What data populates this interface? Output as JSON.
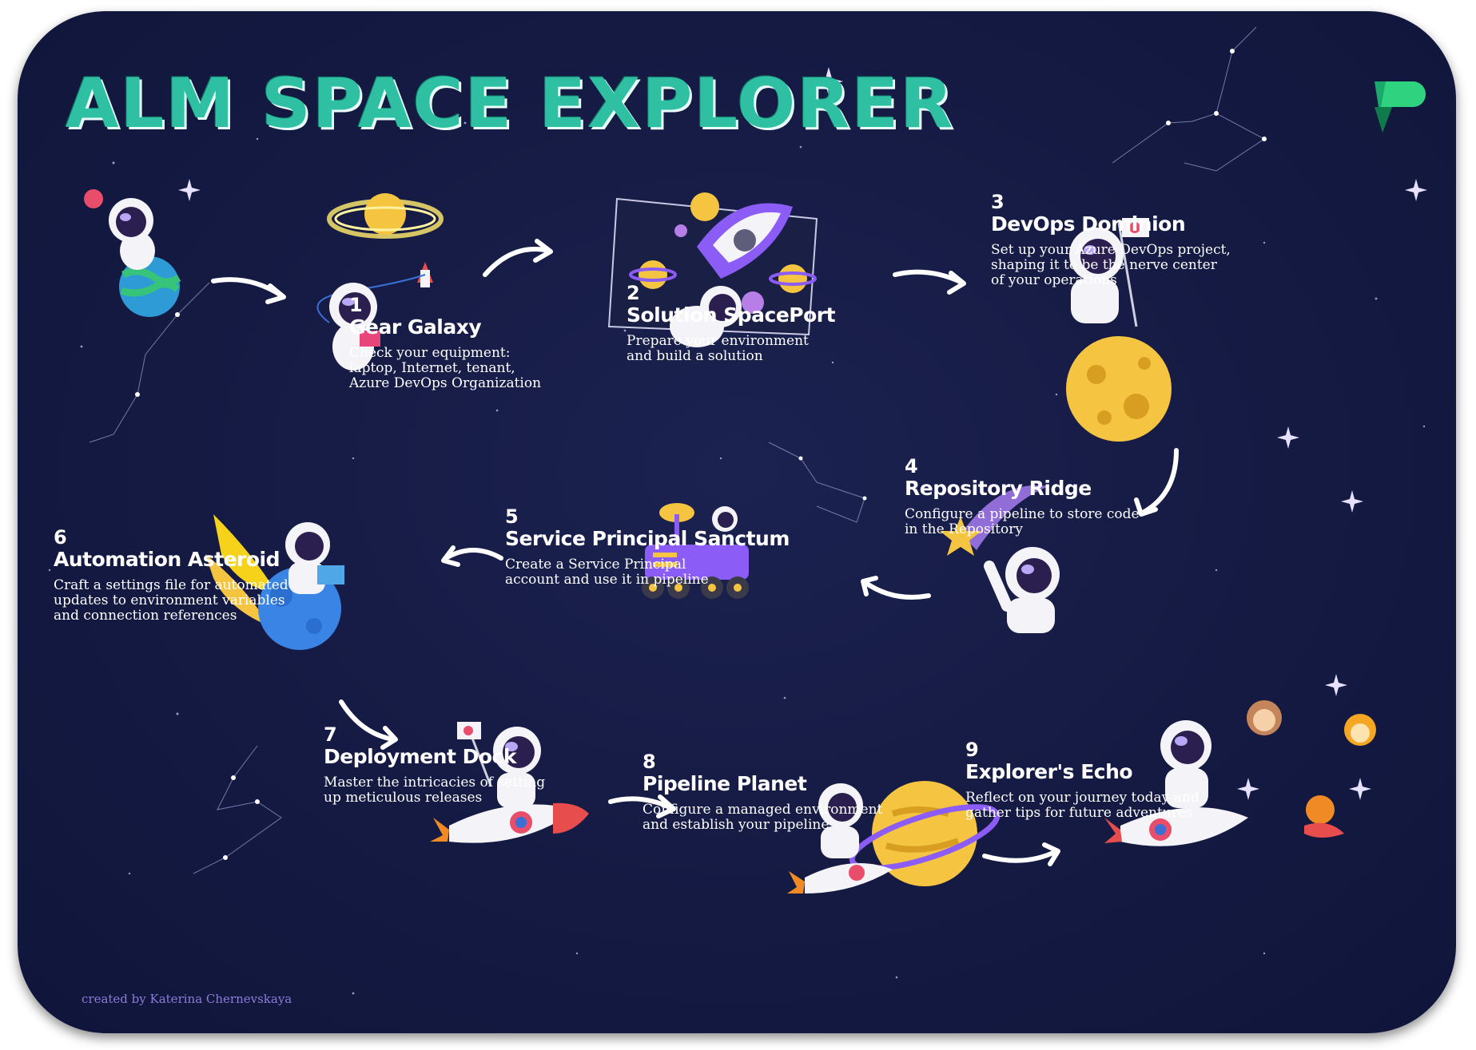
{
  "header": {
    "title": "ALM SPACE EXPLORER",
    "logo_icon": "power-platform-logo-icon"
  },
  "colors": {
    "background": "#141a42",
    "title": "#2fbfa3",
    "text": "#ffffff",
    "credit": "#8c7bd8",
    "planet_yellow": "#f5c542",
    "accent_purple": "#8b5cf6"
  },
  "steps": [
    {
      "num": "1",
      "name": "Gear Galaxy",
      "desc": [
        "Check your equipment:",
        "laptop, Internet, tenant,",
        "Azure DevOps Organization"
      ],
      "icon": "astronaut-with-rocket-icon"
    },
    {
      "num": "2",
      "name": "Solution SpacePort",
      "desc": [
        "Prepare your environment",
        "and build a solution"
      ],
      "icon": "rocket-launch-icon"
    },
    {
      "num": "3",
      "name": "DevOps Dominion",
      "desc": [
        "Set up your Azure DevOps project,",
        "shaping it to be the nerve center",
        "of your operations"
      ],
      "icon": "astronaut-on-moon-icon"
    },
    {
      "num": "4",
      "name": "Repository Ridge",
      "desc": [
        "Configure a pipeline to store code",
        "in the Repository"
      ],
      "icon": "astronaut-pointing-icon"
    },
    {
      "num": "5",
      "name": "Service Principal Sanctum",
      "desc": [
        "Create a Service Principal",
        "account and use it in pipeline"
      ],
      "icon": "space-rover-icon"
    },
    {
      "num": "6",
      "name": "Automation Asteroid",
      "desc": [
        "Craft a settings file for automated",
        "updates to environment variables",
        "and connection references"
      ],
      "icon": "astronaut-on-asteroid-icon"
    },
    {
      "num": "7",
      "name": "Deployment Dock",
      "desc": [
        "Master the intricacies of setting",
        "up meticulous releases"
      ],
      "icon": "astronaut-riding-rocket-icon"
    },
    {
      "num": "8",
      "name": "Pipeline Planet",
      "desc": [
        "Configure a managed environment",
        "and establish your pipeline"
      ],
      "icon": "astronaut-with-planet-icon"
    },
    {
      "num": "9",
      "name": "Explorer's Echo",
      "desc": [
        "Reflect on your journey today and",
        "gather tips for future adventures"
      ],
      "icon": "astronaut-crew-icon"
    }
  ],
  "footer": {
    "credit": "created by Katerina Chernevskaya"
  }
}
